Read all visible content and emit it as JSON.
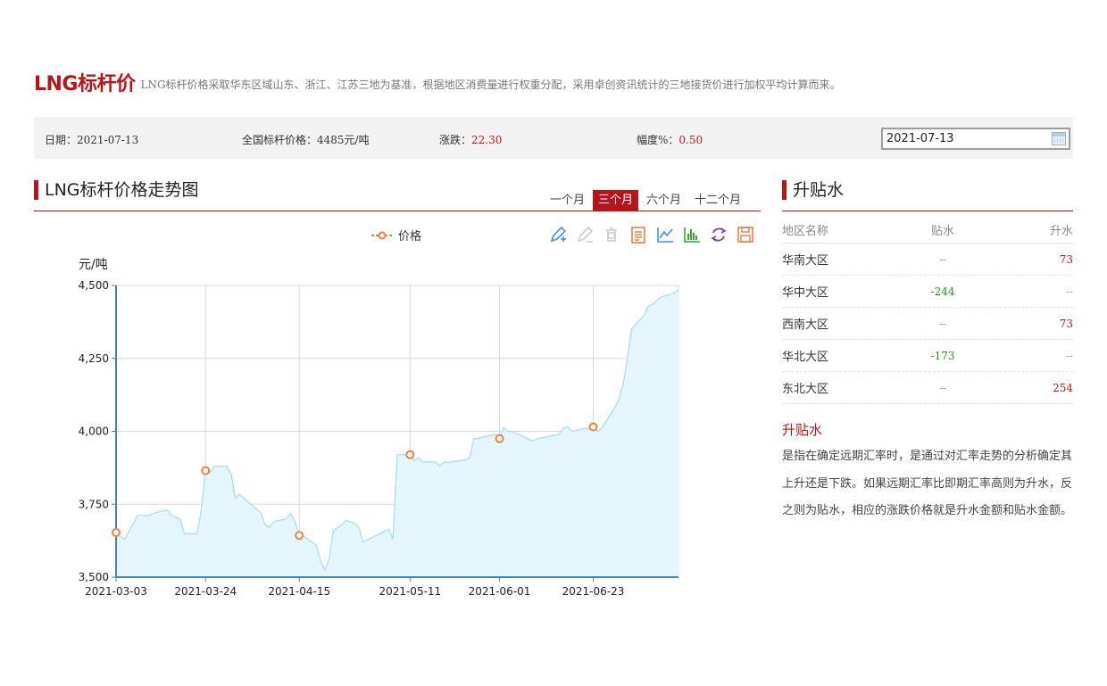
{
  "header": {
    "title": "LNG标杆价",
    "description": "LNG标杆价格采取华东区域山东、浙江、江苏三地为基准，根据地区消费量进行权重分配，采用卓创资讯统计的三地接货价进行加权平均计算而来。"
  },
  "info": {
    "date_label": "日期：",
    "date_value": "2021-07-13",
    "price_label": "全国标杆价格：",
    "price_value": "4485元/吨",
    "change_label": "涨跌：",
    "change_value": "22.30",
    "pct_label": "幅度%：",
    "pct_value": "0.50",
    "date_input_value": "2021-07-13"
  },
  "trend": {
    "title": "LNG标杆价格走势图",
    "tabs": [
      "一个月",
      "三个月",
      "六个月",
      "十二个月"
    ],
    "active_tab": "三个月",
    "legend_label": "价格",
    "toolbox_icons": [
      "mark-pen-icon",
      "erase-mark-icon",
      "clear-mark-icon",
      "data-view-icon",
      "line-chart-icon",
      "bar-chart-icon",
      "restore-icon",
      "save-image-icon"
    ]
  },
  "chart_data": {
    "type": "area",
    "ylabel": "元/吨",
    "ylim": [
      3500,
      4500
    ],
    "yticks": [
      "3,500",
      "3,750",
      "4,000",
      "4,250",
      "4,500"
    ],
    "xtick_labels": [
      "2021-03-03",
      "2021-03-24",
      "2021-04-15",
      "2021-05-11",
      "2021-06-01",
      "2021-06-23"
    ],
    "series": [
      {
        "name": "价格",
        "color": "#e8814a",
        "fill": "#e4f6fc",
        "line": "#a8daf0",
        "x": [
          "2021-03-03",
          "2021-03-04",
          "2021-03-05",
          "2021-03-08",
          "2021-03-09",
          "2021-03-10",
          "2021-03-11",
          "2021-03-12",
          "2021-03-15",
          "2021-03-16",
          "2021-03-17",
          "2021-03-18",
          "2021-03-19",
          "2021-03-22",
          "2021-03-23",
          "2021-03-24",
          "2021-03-25",
          "2021-03-26",
          "2021-03-29",
          "2021-03-30",
          "2021-03-31",
          "2021-04-01",
          "2021-04-02",
          "2021-04-06",
          "2021-04-07",
          "2021-04-08",
          "2021-04-09",
          "2021-04-12",
          "2021-04-13",
          "2021-04-14",
          "2021-04-15",
          "2021-04-16",
          "2021-04-19",
          "2021-04-20",
          "2021-04-21",
          "2021-04-22",
          "2021-04-23",
          "2021-04-25",
          "2021-04-26",
          "2021-04-27",
          "2021-04-28",
          "2021-04-29",
          "2021-04-30",
          "2021-05-06",
          "2021-05-07",
          "2021-05-08",
          "2021-05-10",
          "2021-05-11",
          "2021-05-12",
          "2021-05-13",
          "2021-05-14",
          "2021-05-17",
          "2021-05-18",
          "2021-05-19",
          "2021-05-20",
          "2021-05-21",
          "2021-05-24",
          "2021-05-25",
          "2021-05-26",
          "2021-05-27",
          "2021-05-28",
          "2021-05-31",
          "2021-06-01",
          "2021-06-02",
          "2021-06-03",
          "2021-06-04",
          "2021-06-07",
          "2021-06-08",
          "2021-06-09",
          "2021-06-10",
          "2021-06-11",
          "2021-06-15",
          "2021-06-16",
          "2021-06-17",
          "2021-06-18",
          "2021-06-21",
          "2021-06-22",
          "2021-06-23",
          "2021-06-24",
          "2021-06-25",
          "2021-06-28",
          "2021-06-29",
          "2021-06-30",
          "2021-07-01",
          "2021-07-02",
          "2021-07-05",
          "2021-07-06",
          "2021-07-07",
          "2021-07-08",
          "2021-07-09",
          "2021-07-12",
          "2021-07-13"
        ],
        "values": [
          3653,
          3640,
          3630,
          3710,
          3712,
          3710,
          3713,
          3720,
          3730,
          3715,
          3705,
          3700,
          3650,
          3648,
          3730,
          3865,
          3858,
          3880,
          3880,
          3855,
          3770,
          3785,
          3770,
          3720,
          3680,
          3670,
          3690,
          3700,
          3720,
          3690,
          3643,
          3640,
          3610,
          3556,
          3525,
          3560,
          3660,
          3680,
          3695,
          3690,
          3685,
          3670,
          3620,
          3665,
          3630,
          3920,
          3920,
          3925,
          3900,
          3910,
          3895,
          3895,
          3880,
          3895,
          3893,
          3896,
          3902,
          3910,
          3975,
          3975,
          3980,
          3990,
          3975,
          4012,
          4000,
          3998,
          3980,
          3970,
          3968,
          3975,
          3978,
          3990,
          4012,
          4015,
          4000,
          4010,
          4008,
          4015,
          4000,
          4010,
          4080,
          4110,
          4160,
          4250,
          4350,
          4400,
          4430,
          4435,
          4450,
          4460,
          4475,
          4485
        ],
        "markers": [
          {
            "x": "2021-03-03",
            "y": 3653
          },
          {
            "x": "2021-03-24",
            "y": 3865
          },
          {
            "x": "2021-04-15",
            "y": 3643
          },
          {
            "x": "2021-05-11",
            "y": 3920
          },
          {
            "x": "2021-06-01",
            "y": 3975
          },
          {
            "x": "2021-06-23",
            "y": 4015
          }
        ]
      }
    ]
  },
  "spread": {
    "title": "升贴水",
    "headers": [
      "地区名称",
      "贴水",
      "升水"
    ],
    "rows": [
      {
        "region": "华南大区",
        "discount": "--",
        "premium": "73"
      },
      {
        "region": "华中大区",
        "discount": "-244",
        "premium": "--"
      },
      {
        "region": "西南大区",
        "discount": "--",
        "premium": "73"
      },
      {
        "region": "华北大区",
        "discount": "-173",
        "premium": "--"
      },
      {
        "region": "东北大区",
        "discount": "--",
        "premium": "254"
      }
    ],
    "definition_title": "升贴水",
    "definition_text": "是指在确定远期汇率时，是通过对汇率走势的分析确定其上升还是下跌。如果远期汇率比即期汇率高则为升水，反之则为贴水，相应的涨跌价格就是升水金额和贴水金额。"
  },
  "colors": {
    "brand_red": "#b5151d",
    "value_red": "#c4161c",
    "value_green": "#2e8b2e",
    "marker_orange": "#e8814a"
  }
}
